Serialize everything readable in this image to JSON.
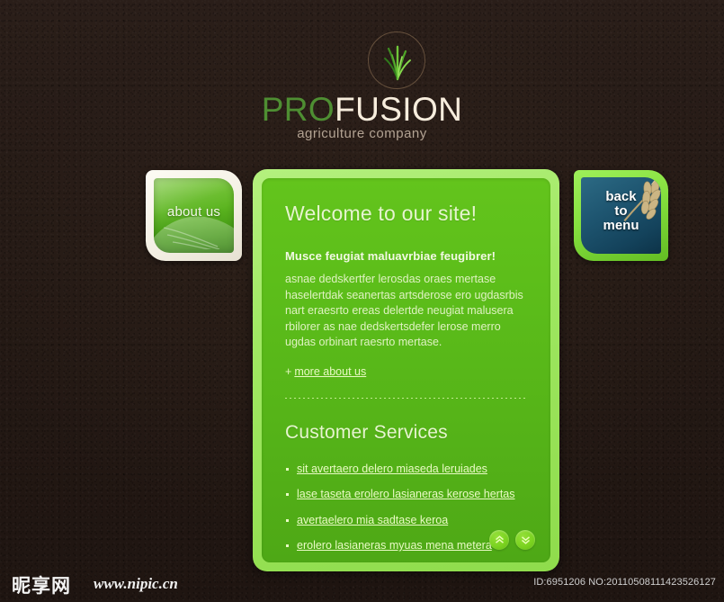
{
  "brand": {
    "logo_icon": "grass-icon",
    "name_part1": "PRO",
    "name_part2": "FUSION",
    "tagline": "agriculture company"
  },
  "nav": {
    "about_button_label": "about us",
    "menu_button_label": "back\nto\nmenu",
    "menu_button_icon": "wheat-icon"
  },
  "main": {
    "welcome_heading": "Welcome to our site!",
    "intro_subheading": "Musce feugiat maluavrbiae feugibrer!",
    "intro_body": "asnae dedskertfer lerosdas oraes mertase haselertdak seanertas artsderose ero ugdasrbis nart eraesrto ereas delertde neugiat malusera rbilorer as nae dedskertsdefer lerose merro ugdas orbinart raesrto mertase.",
    "more_link_plus": "+",
    "more_link_label": "more about us",
    "services_heading": "Customer Services",
    "services": [
      "sit avertaero delero miaseda leruiades",
      "lase taseta erolero lasianeras kerose hertas",
      "avertaelero mia sadtase keroa",
      "erolero lasianeras myuas mena metera"
    ]
  },
  "scroll": {
    "up_icon": "chevron-double-up-icon",
    "down_icon": "chevron-double-down-icon"
  },
  "footer": {
    "watermark_cn": "昵享网",
    "watermark_url": "www.nipic.cn",
    "watermark_id": "ID:6951206 NO:20110508111423526127"
  },
  "colors": {
    "background": "#271c17",
    "panel_frame": "#a0e863",
    "panel_body": "#5cbd1a",
    "brand_green": "#4e8e32",
    "brand_cream": "#f7eddd",
    "menu_btn_blue": "#1e5570",
    "link_text": "#e9fbc5"
  }
}
